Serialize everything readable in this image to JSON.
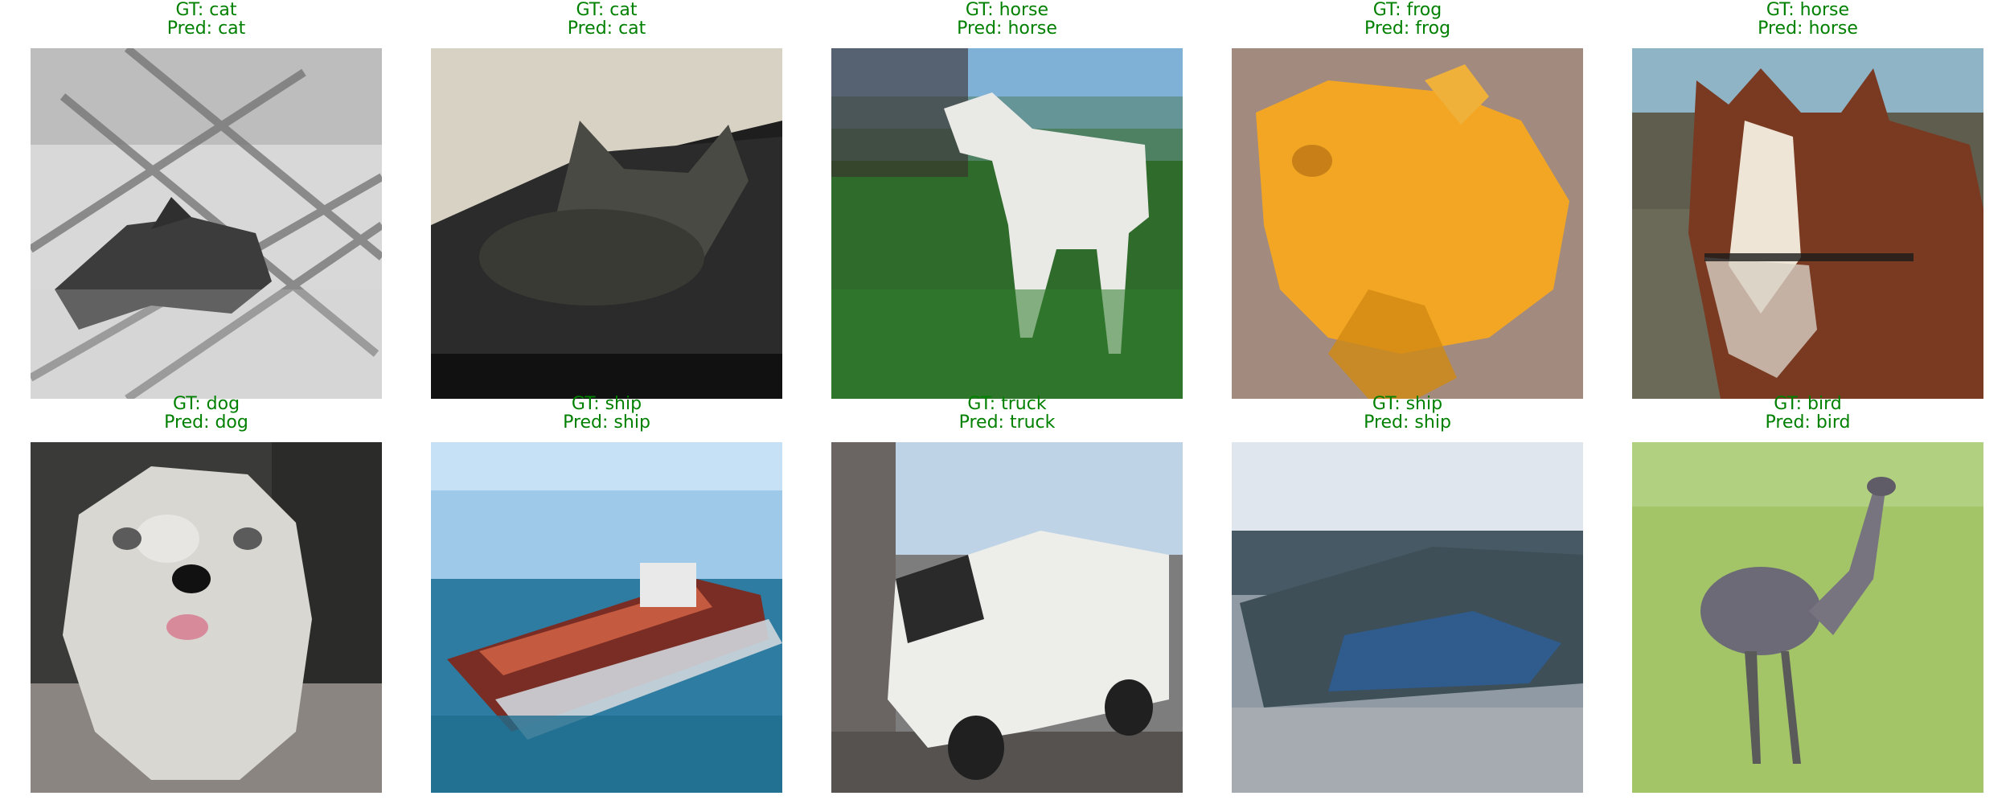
{
  "figure": {
    "caption_color": "#008000",
    "panels": [
      {
        "gt_text": "GT: cat",
        "pred_text": "Pred: cat",
        "image_subject": "cat-icon"
      },
      {
        "gt_text": "GT: cat",
        "pred_text": "Pred: cat",
        "image_subject": "cat-icon"
      },
      {
        "gt_text": "GT: horse",
        "pred_text": "Pred: horse",
        "image_subject": "horse-icon"
      },
      {
        "gt_text": "GT: frog",
        "pred_text": "Pred: frog",
        "image_subject": "frog-icon"
      },
      {
        "gt_text": "GT: horse",
        "pred_text": "Pred: horse",
        "image_subject": "horse-icon"
      },
      {
        "gt_text": "GT: dog",
        "pred_text": "Pred: dog",
        "image_subject": "dog-icon"
      },
      {
        "gt_text": "GT: ship",
        "pred_text": "Pred: ship",
        "image_subject": "ship-icon"
      },
      {
        "gt_text": "GT: truck",
        "pred_text": "Pred: truck",
        "image_subject": "truck-icon"
      },
      {
        "gt_text": "GT: ship",
        "pred_text": "Pred: ship",
        "image_subject": "ship-icon"
      },
      {
        "gt_text": "GT: bird",
        "pred_text": "Pred: bird",
        "image_subject": "bird-icon"
      }
    ]
  }
}
